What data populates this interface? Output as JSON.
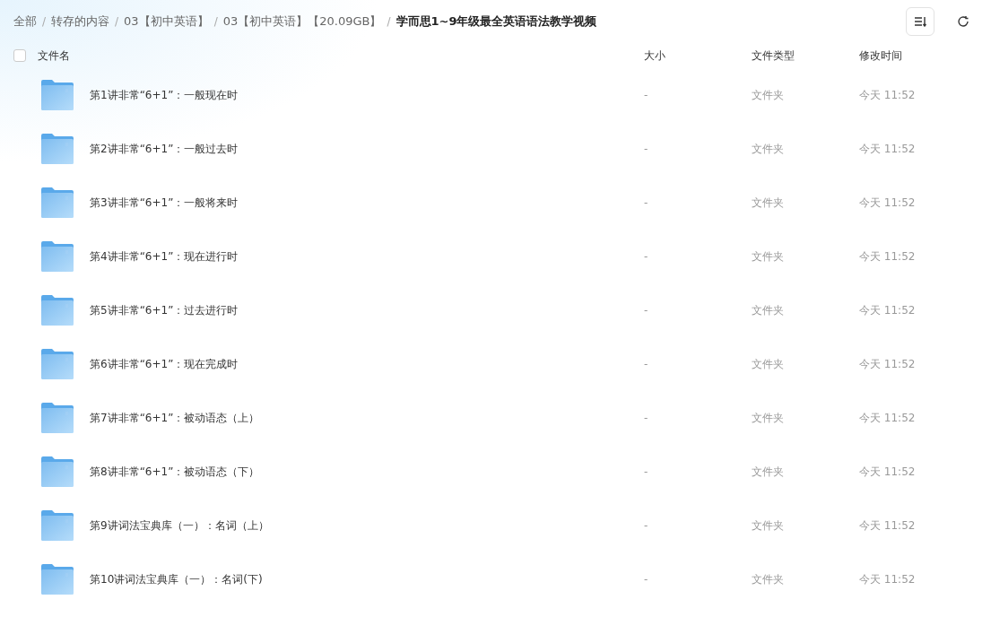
{
  "breadcrumb": [
    {
      "label": "全部",
      "current": false
    },
    {
      "separator": "/",
      "label": "转存的内容",
      "current": false
    },
    {
      "separator": "/",
      "label": "03【初中英语】",
      "current": false
    },
    {
      "separator": "/",
      "label": "03【初中英语】【20.09GB】",
      "current": false
    },
    {
      "separator": "/",
      "label": "学而思1~9年级最全英语语法教学视频",
      "current": true
    }
  ],
  "table": {
    "select_all": {
      "checked": false
    },
    "columns": [
      "文件名",
      "大小",
      "文件类型",
      "修改时间"
    ],
    "rows": [
      {
        "name": "第1讲非常“6+1”：一般现在时",
        "size": "-",
        "type": "文件夹",
        "modified": "今天 11:52"
      },
      {
        "name": "第2讲非常“6+1”：一般过去时",
        "size": "-",
        "type": "文件夹",
        "modified": "今天 11:52"
      },
      {
        "name": "第3讲非常“6+1”：一般将来时",
        "size": "-",
        "type": "文件夹",
        "modified": "今天 11:52"
      },
      {
        "name": "第4讲非常“6+1”：现在进行时",
        "size": "-",
        "type": "文件夹",
        "modified": "今天 11:52"
      },
      {
        "name": "第5讲非常“6+1”：过去进行时",
        "size": "-",
        "type": "文件夹",
        "modified": "今天 11:52"
      },
      {
        "name": "第6讲非常“6+1”：现在完成时",
        "size": "-",
        "type": "文件夹",
        "modified": "今天 11:52"
      },
      {
        "name": "第7讲非常“6+1”：被动语态（上）",
        "size": "-",
        "type": "文件夹",
        "modified": "今天 11:52"
      },
      {
        "name": "第8讲非常“6+1”：被动语态（下）",
        "size": "-",
        "type": "文件夹",
        "modified": "今天 11:52"
      },
      {
        "name": "第9讲词法宝典库（一）：名词（上）",
        "size": "-",
        "type": "文件夹",
        "modified": "今天 11:52"
      },
      {
        "name": "第10讲词法宝典库（一）：名词(下)",
        "size": "-",
        "type": "文件夹",
        "modified": "今天 11:52"
      }
    ]
  }
}
